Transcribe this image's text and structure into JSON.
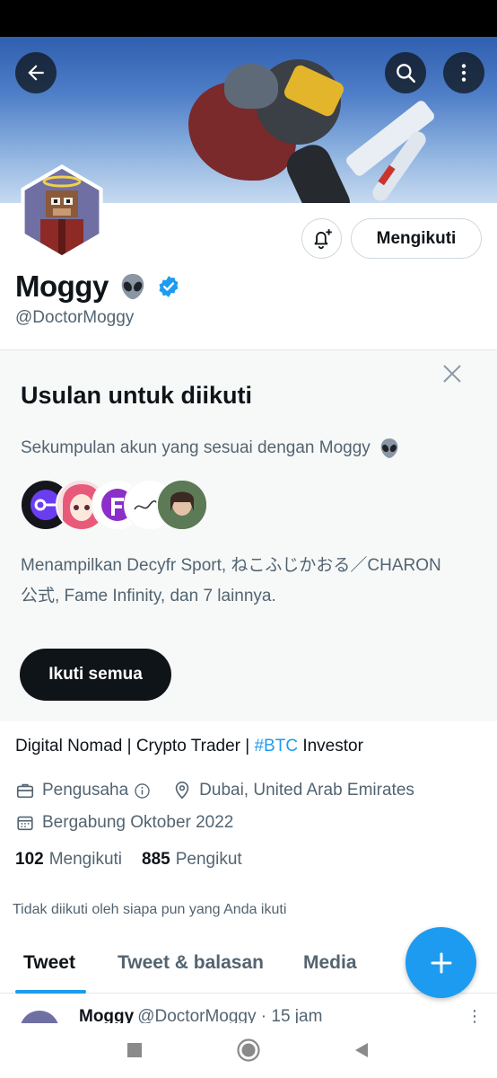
{
  "header": {
    "back_icon": "arrow-left-icon",
    "search_icon": "search-icon",
    "more_icon": "more-vertical-icon"
  },
  "profile": {
    "display_name": "Moggy",
    "handle": "@DoctorMoggy",
    "verified": true,
    "follow_button_label": "Mengikuti",
    "notify_icon": "bell-plus-icon"
  },
  "suggestions": {
    "title": "Usulan untuk diikuti",
    "subtitle": "Sekumpulan akun yang sesuai dengan Moggy",
    "description": "Menampilkan Decyfr Sport, ねこふじかおる／CHARON公式, Fame Infinity, dan 7 lainnya.",
    "follow_all_label": "Ikuti semua"
  },
  "bio": {
    "text_before": "Digital Nomad | Crypto Trader | ",
    "hashtag": "#BTC",
    "text_after": " Investor"
  },
  "meta": {
    "category": "Pengusaha",
    "location": "Dubai, United Arab Emirates",
    "joined": "Bergabung Oktober 2022"
  },
  "counts": {
    "following_num": "102",
    "following_label": "Mengikuti",
    "followers_num": "885",
    "followers_label": "Pengikut"
  },
  "not_followed_text": "Tidak diikuti oleh siapa pun yang Anda ikuti",
  "tabs": [
    {
      "label": "Tweet",
      "active": true
    },
    {
      "label": "Tweet & balasan",
      "active": false
    },
    {
      "label": "Media",
      "active": false
    }
  ],
  "peek_tweet": {
    "name": "Moggy",
    "handle_time": "@DoctorMoggy · 15 jam"
  },
  "colors": {
    "accent": "#1d9bf0",
    "text": "#0f1419",
    "secondary": "#536471",
    "card_bg": "#f7f9f9"
  }
}
